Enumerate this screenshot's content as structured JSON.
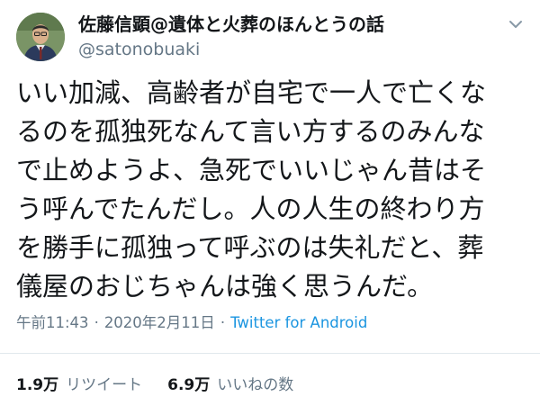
{
  "tweet": {
    "author": {
      "display_name": "佐藤信顕@遺体と火葬のほんとうの話",
      "handle": "@satonobuaki"
    },
    "text_lines": [
      "いい加減、高齢者が自宅で一人で亡くな",
      "るのを孤独死なんて言い方するのみんな",
      "で止めようよ、急死でいいじゃん昔はそ",
      "う呼んでたんだし。人の人生の終わり方",
      "を勝手に孤独って呼ぶのは失礼だと、葬",
      "儀屋のおじちゃんは強く思うんだ。"
    ],
    "time": "午前11:43",
    "separator": "·",
    "date": "2020年2月11日",
    "source": "Twitter for Android",
    "retweets": {
      "count": "1.9万",
      "label": "リツイート"
    },
    "likes": {
      "count": "6.9万",
      "label": "いいねの数"
    }
  },
  "icons": {
    "menu": "chevron-down-icon",
    "avatar": "avatar"
  },
  "colors": {
    "text": "#14171a",
    "secondary": "#657786",
    "link": "#1b95e0",
    "divider": "#e1e8ed"
  }
}
